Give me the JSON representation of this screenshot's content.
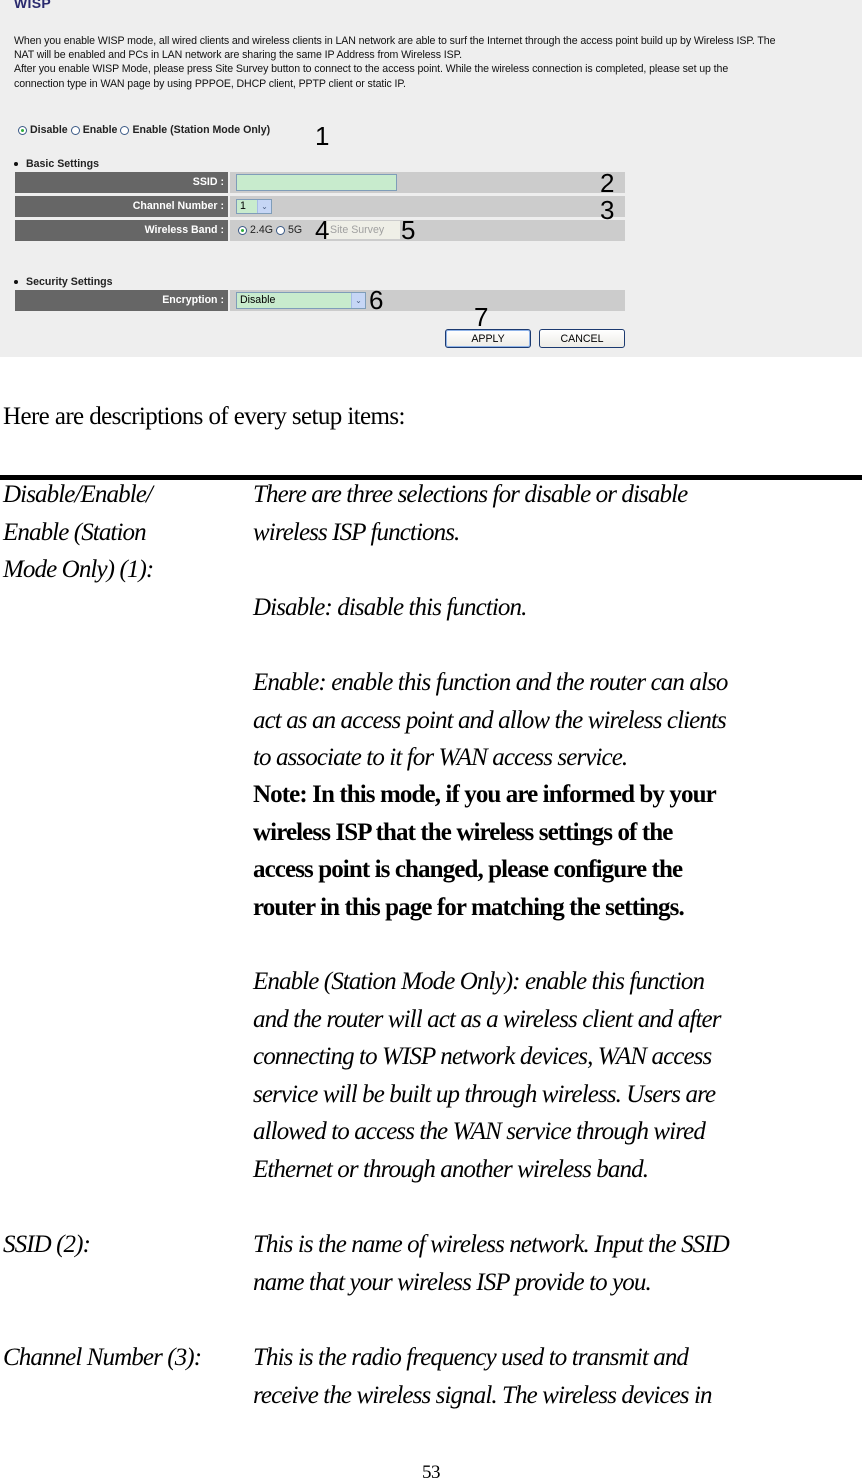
{
  "screenshot": {
    "title": "WISP",
    "description_lines": [
      "When you enable WISP mode, all wired clients and wireless clients in LAN network are able to surf the Internet through the access point build up by Wireless ISP. The",
      "NAT will be enabled and PCs in LAN network are sharing the same IP Address from Wireless ISP.",
      "After you enable WISP Mode, please press Site Survey button to connect to the access point. While the wireless connection is completed, please set up the",
      "connection type in WAN page by using PPPOE, DHCP client, PPTP client or static IP."
    ],
    "mode_options": [
      {
        "label": "Disable",
        "checked": true
      },
      {
        "label": "Enable",
        "checked": false
      },
      {
        "label": "Enable (Station Mode Only)",
        "checked": false
      }
    ],
    "basic_settings": {
      "heading": "Basic Settings",
      "ssid_label": "SSID :",
      "ssid_value": "",
      "channel_label": "Channel Number :",
      "channel_value": "1",
      "band_label": "Wireless Band :",
      "band_options": [
        {
          "label": "2.4G",
          "checked": true
        },
        {
          "label": "5G",
          "checked": false
        }
      ],
      "site_survey_label": "Site Survey"
    },
    "security_settings": {
      "heading": "Security Settings",
      "encryption_label": "Encryption :",
      "encryption_value": "Disable"
    },
    "apply_label": "APPLY",
    "cancel_label": "CANCEL",
    "callouts": [
      "1",
      "2",
      "3",
      "4",
      "5",
      "6",
      "7"
    ],
    "colors": {
      "panel_bg": "#eeeeee",
      "label_bg": "#666666",
      "value_bg": "#cccccc",
      "input_bg": "#c8ebcd",
      "title_color": "#2a2a6e"
    }
  },
  "document": {
    "intro": "Here are descriptions of every setup items:",
    "items": [
      {
        "term_lines": [
          "Disable/Enable/",
          "Enable (Station",
          "Mode Only) (1):"
        ],
        "intro_lines": [
          "There are three selections for disable or disable",
          "wireless ISP functions."
        ],
        "disable_line": "Disable: disable this function.",
        "enable_lines": [
          "Enable: enable this function and the router can also",
          "act as an access point and allow the wireless clients",
          "to associate to it for WAN access service."
        ],
        "note_lines": [
          "Note: In this mode, if you are informed by your",
          "wireless ISP that the wireless settings of the",
          "access point is changed, please configure the",
          "router in this page for matching the settings."
        ],
        "station_lines": [
          "Enable (Station Mode Only): enable this function",
          "and the router will act as a wireless client and after",
          "connecting to WISP network devices, WAN access",
          "service will be built up through wireless. Users are",
          "allowed to access the WAN service through wired",
          "Ethernet or through another wireless band."
        ]
      },
      {
        "term": "SSID (2):",
        "desc_lines": [
          "This is the name of wireless network. Input the SSID",
          "name that your wireless ISP provide to you."
        ]
      },
      {
        "term": "Channel Number (3):",
        "desc_lines": [
          "This is the radio frequency used to transmit and",
          "receive the wireless signal. The wireless devices in"
        ]
      }
    ],
    "page_number": "53"
  }
}
